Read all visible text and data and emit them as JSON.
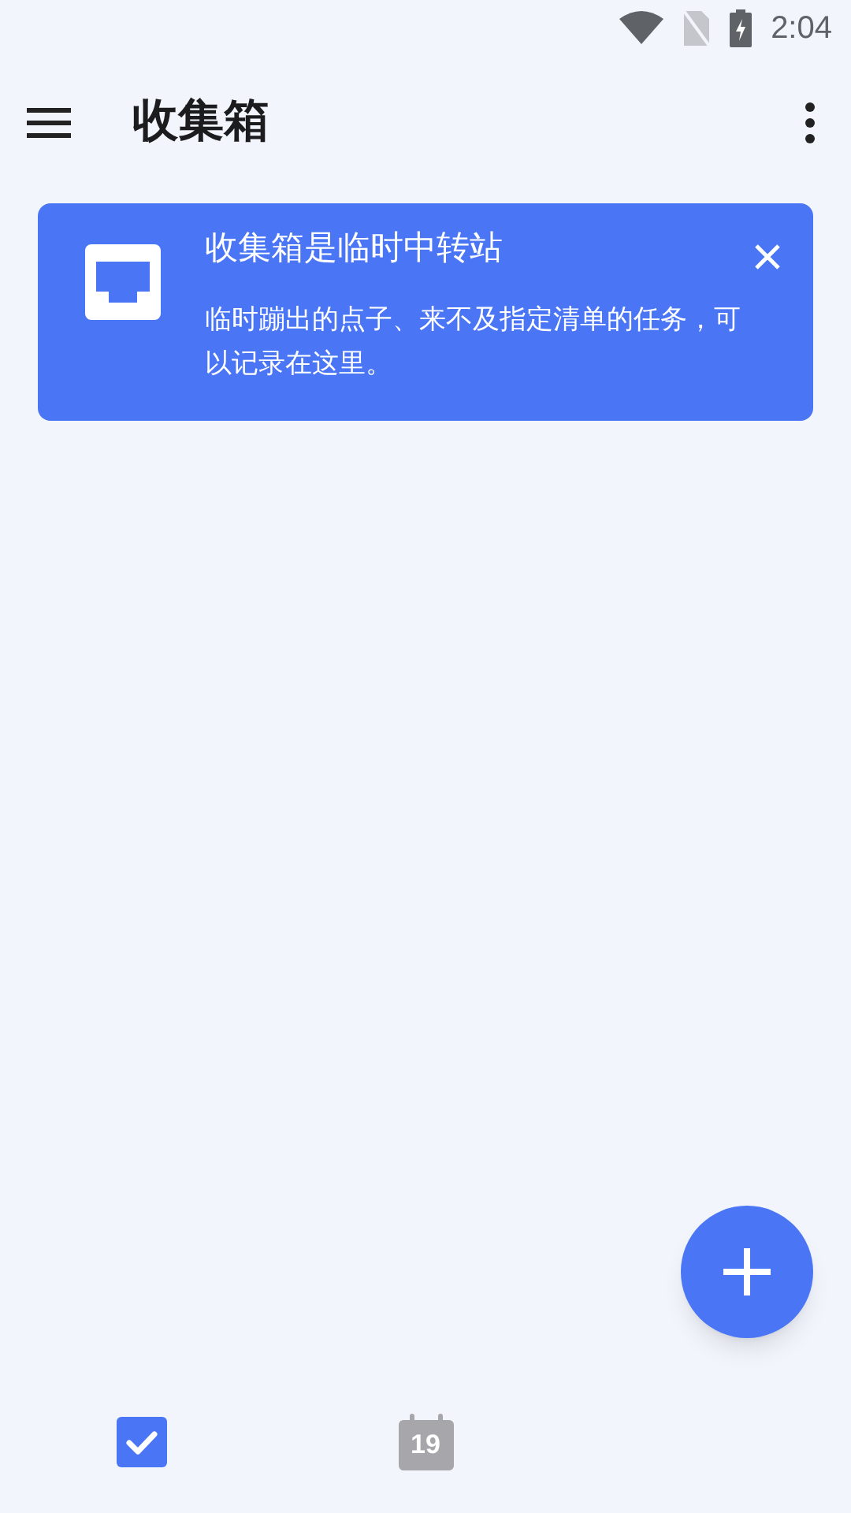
{
  "status_bar": {
    "time": "2:04"
  },
  "app_bar": {
    "title": "收集箱"
  },
  "info_card": {
    "title": "收集箱是临时中转站",
    "body": "临时蹦出的点子、来不及指定清单的任务，可以记录在这里。"
  },
  "bottom_nav": [
    {
      "kind": "tasks",
      "selected": true
    },
    {
      "kind": "calendar",
      "selected": false,
      "day": "19"
    }
  ]
}
